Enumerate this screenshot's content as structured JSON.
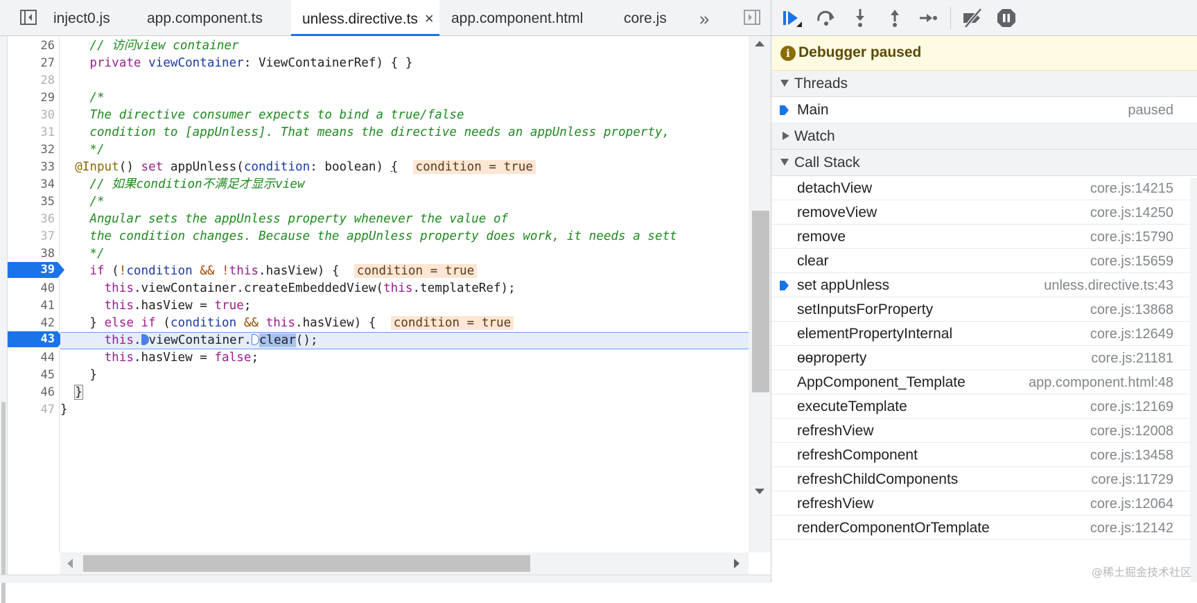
{
  "editor": {
    "tabs": [
      {
        "label": "inject0.js",
        "active": false
      },
      {
        "label": "app.component.ts",
        "active": false
      },
      {
        "label": "unless.directive.ts",
        "active": true,
        "close": "×"
      },
      {
        "label": "app.component.html",
        "active": false
      },
      {
        "label": "core.js",
        "active": false
      }
    ],
    "more_tabs": "»",
    "line_numbers": [
      "26",
      "27",
      "28",
      "29",
      "30",
      "31",
      "32",
      "33",
      "34",
      "35",
      "36",
      "37",
      "38",
      "39",
      "40",
      "41",
      "42",
      "43",
      "44",
      "45",
      "46",
      "47"
    ],
    "breakpoint_lines": [
      "39",
      "43"
    ],
    "paused_line": "43",
    "code": {
      "l26": "// 访问view container",
      "l27_kw": "private",
      "l27_prop": "viewContainer",
      "l27_rest": ": ViewContainerRef) { }",
      "l29": "/*",
      "l30": "The directive consumer expects to bind a true/false",
      "l31": "condition to [appUnless]. That means the directive needs an appUnless property,",
      "l32": "*/",
      "l33_dec": "@Input",
      "l33_a": "() ",
      "l33_kw": "set",
      "l33_b": " appUnless(",
      "l33_prop": "condition",
      "l33_c": ": boolean) ",
      "l33_brace": "{",
      "l34": "// 如果condition不满足才显示view",
      "l35": "/*",
      "l36": "Angular sets the appUnless property whenever the value of",
      "l37": "the condition changes. Because the appUnless property does work, it needs a sett",
      "l38": "*/",
      "l39_kw": "if",
      "l39_a": " (",
      "l39_op1": "!",
      "l39_prop": "condition",
      "l39_op2": " && !",
      "l39_kw2": "this",
      "l39_b": ".hasView) {",
      "l40_kw": "this",
      "l40_a": ".viewContainer.createEmbeddedView(",
      "l40_kw2": "this",
      "l40_b": ".templateRef);",
      "l41_kw": "this",
      "l41_a": ".hasView = ",
      "l41_kw2": "true",
      "l41_b": ";",
      "l42_a": "} ",
      "l42_kw": "else if",
      "l42_b": " (",
      "l42_prop": "condition",
      "l42_op": " && ",
      "l42_kw2": "this",
      "l42_c": ".hasView) {",
      "l43_kw": "this",
      "l43_a": ".",
      "l43_b": "viewContainer.",
      "l43_sel": "clear",
      "l43_c": "();",
      "l44_kw": "this",
      "l44_a": ".hasView = ",
      "l44_kw2": "false",
      "l44_b": ";",
      "l45": "}",
      "l46": "}",
      "l47": "}"
    },
    "inline_values": {
      "l33": "condition = true",
      "l39": "condition = true",
      "l42": "condition = true"
    }
  },
  "debugger": {
    "status": "Debugger paused",
    "info_icon": "i",
    "sections": {
      "threads": "Threads",
      "watch": "Watch",
      "call_stack": "Call Stack"
    },
    "thread": {
      "name": "Main",
      "state": "paused"
    },
    "call_stack": [
      {
        "name": "detachView",
        "location": "core.js:14215",
        "current": false
      },
      {
        "name": "removeView",
        "location": "core.js:14250",
        "current": false
      },
      {
        "name": "remove",
        "location": "core.js:15790",
        "current": false
      },
      {
        "name": "clear",
        "location": "core.js:15659",
        "current": false
      },
      {
        "name": "set appUnless",
        "location": "unless.directive.ts:43",
        "current": true
      },
      {
        "name": "setInputsForProperty",
        "location": "core.js:13868",
        "current": false
      },
      {
        "name": "elementPropertyInternal",
        "location": "core.js:12649",
        "current": false
      },
      {
        "name": "ɵɵproperty",
        "location": "core.js:21181",
        "current": false
      },
      {
        "name": "AppComponent_Template",
        "location": "app.component.html:48",
        "current": false
      },
      {
        "name": "executeTemplate",
        "location": "core.js:12169",
        "current": false
      },
      {
        "name": "refreshView",
        "location": "core.js:12008",
        "current": false
      },
      {
        "name": "refreshComponent",
        "location": "core.js:13458",
        "current": false
      },
      {
        "name": "refreshChildComponents",
        "location": "core.js:11729",
        "current": false
      },
      {
        "name": "refreshView",
        "location": "core.js:12064",
        "current": false
      },
      {
        "name": "renderComponentOrTemplate",
        "location": "core.js:12142",
        "current": false
      }
    ],
    "watermark": "@稀土掘金技术社区",
    "colors": {
      "accent": "#1a73e8",
      "banner": "#fffbe3",
      "inline_value_bg": "#fde6d3"
    }
  }
}
